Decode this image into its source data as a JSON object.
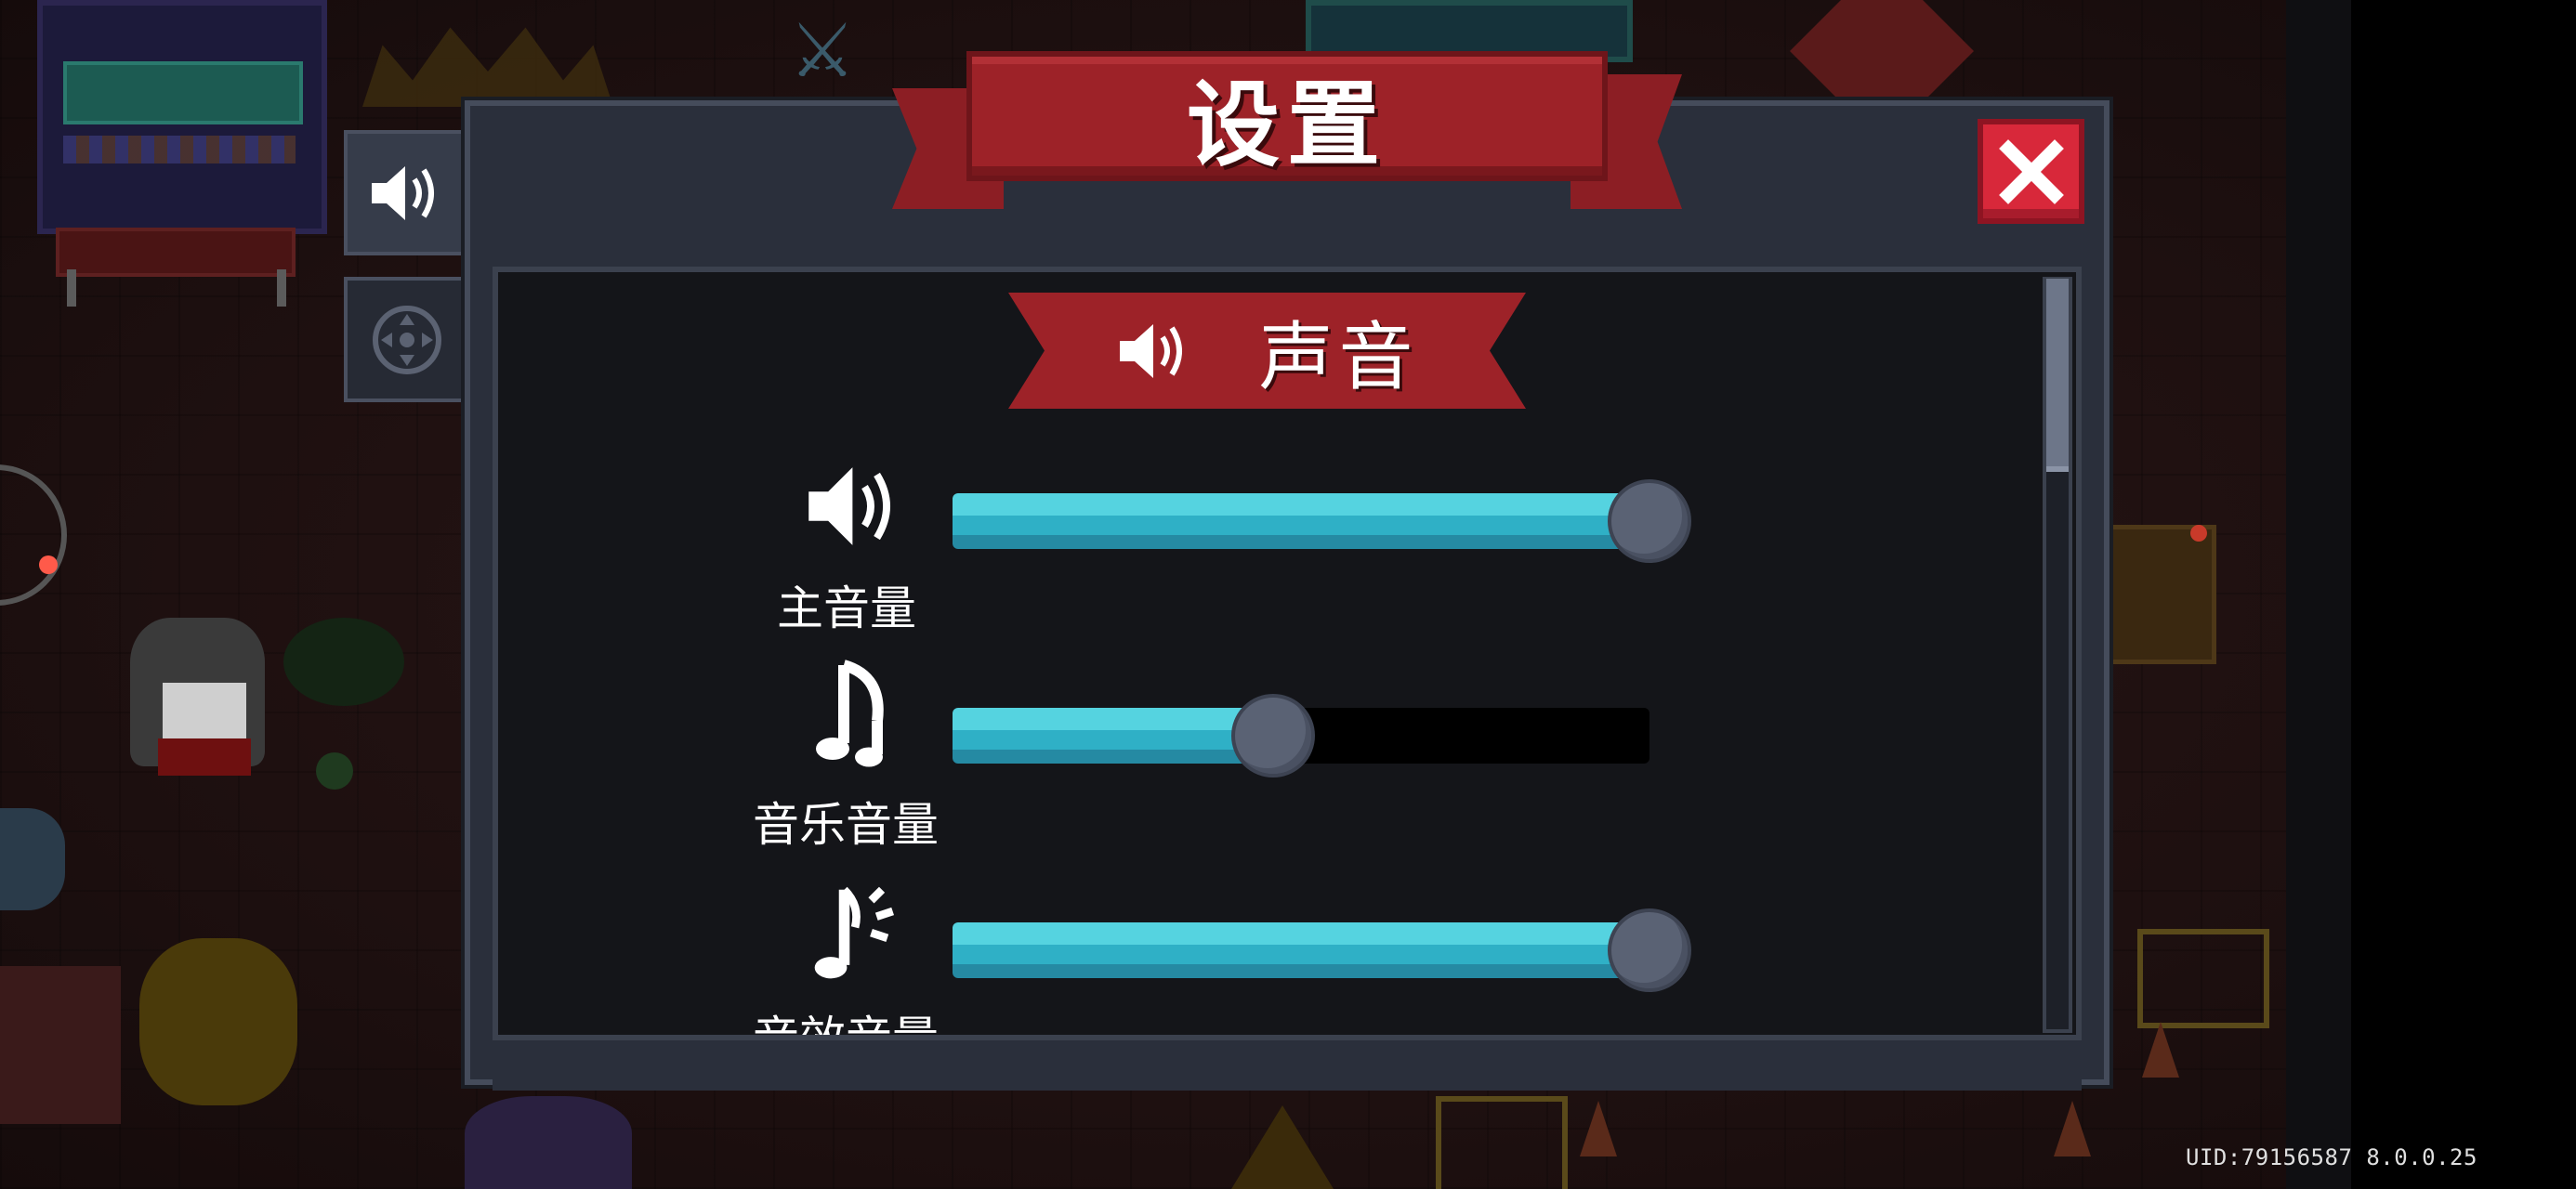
{
  "dialog": {
    "title": "设置",
    "close_label": "",
    "section_title": "声音"
  },
  "tabs": [
    {
      "icon": "speaker-icon",
      "active": true
    },
    {
      "icon": "dpad-icon",
      "active": false
    }
  ],
  "sliders": [
    {
      "label": "主音量",
      "icon": "speaker-icon",
      "value_percent": 100
    },
    {
      "label": "音乐音量",
      "icon": "music-note-icon",
      "value_percent": 46
    },
    {
      "label": "音效音量",
      "icon": "sound-effect-icon",
      "value_percent": 100
    }
  ],
  "footer": {
    "uid_text": "UID:79156587 8.0.0.25"
  },
  "colors": {
    "accent_red": "#9d2228",
    "close_red": "#d8283a",
    "slider_fill": "#2fb0c6",
    "panel_bg": "#2a2f3b"
  }
}
